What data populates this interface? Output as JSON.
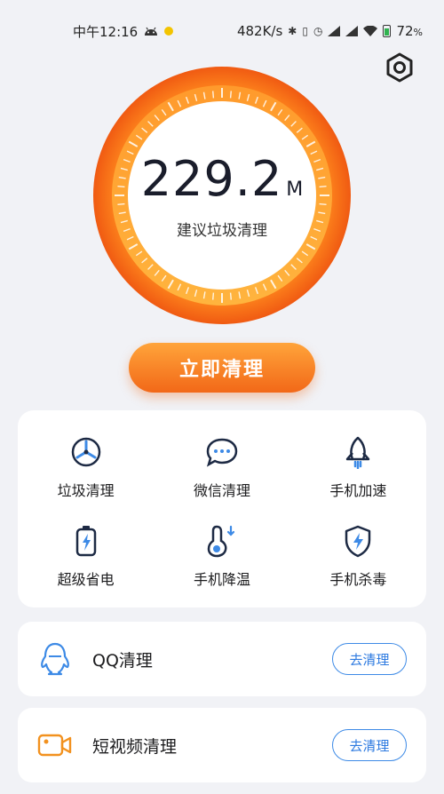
{
  "status_bar": {
    "time": "中午12:16",
    "speed": "482K/s",
    "battery": "72",
    "battery_unit": "%"
  },
  "header": {
    "settings_icon": "gear-icon"
  },
  "gauge": {
    "value": "229.2",
    "unit": "M",
    "label": "建议垃圾清理",
    "colors": {
      "outer": "#f26818",
      "inner": "#ffb13b"
    }
  },
  "clean_button": {
    "label": "立即清理"
  },
  "features": [
    {
      "label": "垃圾清理",
      "icon": "fan-icon"
    },
    {
      "label": "微信清理",
      "icon": "chat-bubble-icon"
    },
    {
      "label": "手机加速",
      "icon": "rocket-icon"
    },
    {
      "label": "超级省电",
      "icon": "battery-bolt-icon"
    },
    {
      "label": "手机降温",
      "icon": "thermometer-icon"
    },
    {
      "label": "手机杀毒",
      "icon": "shield-bolt-icon"
    }
  ],
  "list": [
    {
      "title": "QQ清理",
      "button": "去清理",
      "icon": "penguin-icon"
    },
    {
      "title": "短视频清理",
      "button": "去清理",
      "icon": "video-camera-icon"
    }
  ],
  "colors": {
    "accent_blue": "#2d7ae0",
    "accent_orange": "#f26818",
    "background": "#f1f2f6"
  }
}
